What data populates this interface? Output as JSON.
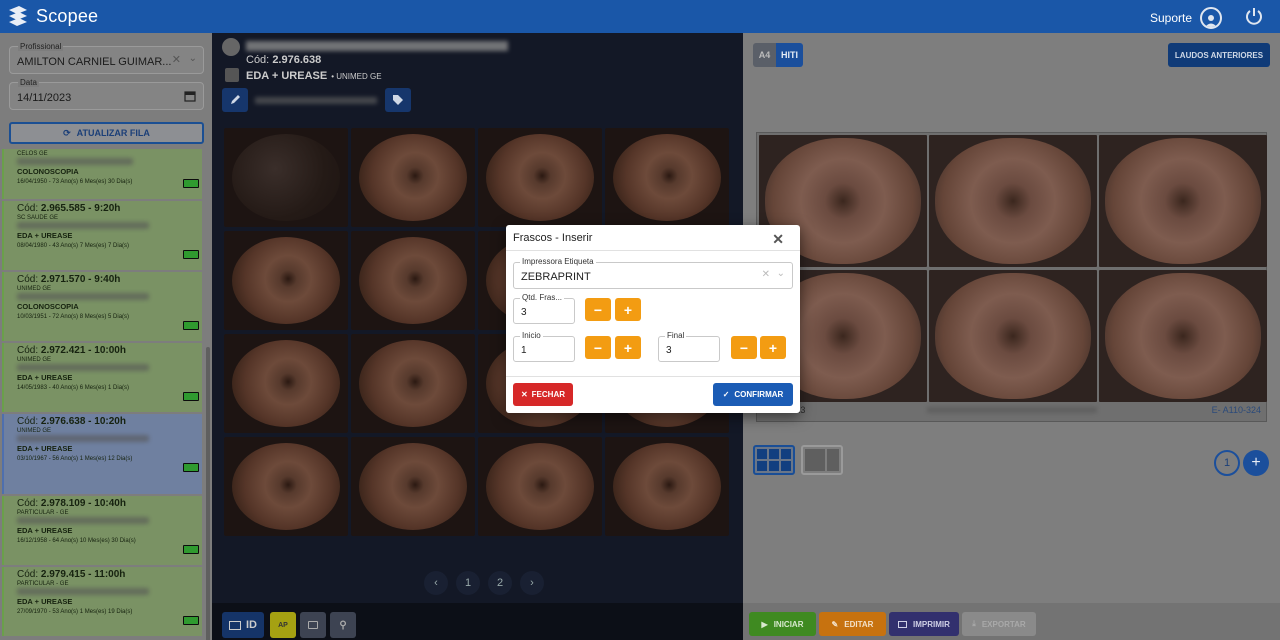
{
  "app": {
    "name": "Scopee",
    "support_label": "Suporte"
  },
  "filters": {
    "profissional_label": "Profissional",
    "profissional_value": "AMILTON CARNIEL GUIMAR...",
    "data_label": "Data",
    "data_value": "14/11/2023",
    "refresh_label": "ATUALIZAR FILA"
  },
  "queue": [
    {
      "cod_prefix": "",
      "cod": "",
      "time": "",
      "insurer": "CELOS GE",
      "exam": "COLONOSCOPIA",
      "info": "16/04/1950 - 73 Ano(s) 6 Mes(es) 30 Dia(s)",
      "selected": false
    },
    {
      "cod_prefix": "Cód: ",
      "cod": "2.965.585 - 9:20h",
      "insurer": "SC SAUDE GE",
      "exam": "EDA + UREASE",
      "info": "08/04/1980 - 43 Ano(s) 7 Mes(es) 7 Dia(s)",
      "selected": false
    },
    {
      "cod_prefix": "Cód: ",
      "cod": "2.971.570 - 9:40h",
      "insurer": "UNIMED GE",
      "exam": "COLONOSCOPIA",
      "info": "10/03/1951 - 72 Ano(s) 8 Mes(es) 5 Dia(s)",
      "selected": false
    },
    {
      "cod_prefix": "Cód: ",
      "cod": "2.972.421 - 10:00h",
      "insurer": "UNIMED GE",
      "exam": "EDA + UREASE",
      "info": "14/05/1983 - 40 Ano(s) 6 Mes(es) 1 Dia(s)",
      "selected": false
    },
    {
      "cod_prefix": "Cód: ",
      "cod": "2.976.638 - 10:20h",
      "insurer": "UNIMED GE",
      "exam": "EDA + UREASE",
      "info": "03/10/1967 - 56 Ano(s) 1 Mes(es) 12 Dia(s)",
      "selected": true
    },
    {
      "cod_prefix": "Cód: ",
      "cod": "2.978.109 - 10:40h",
      "insurer": "PARTICULAR - GE",
      "exam": "EDA + UREASE",
      "info": "16/12/1958 - 64 Ano(s) 10 Mes(es) 30 Dia(s)",
      "selected": false
    },
    {
      "cod_prefix": "Cód: ",
      "cod": "2.979.415 - 11:00h",
      "insurer": "PARTICULAR - GE",
      "exam": "EDA + UREASE",
      "info": "27/09/1970 - 53 Ano(s) 1 Mes(es) 19 Dia(s)",
      "selected": false
    }
  ],
  "patient": {
    "cod_label": "Cód:",
    "cod": "2.976.638",
    "exam": "EDA + UREASE",
    "insurer": "• UNIMED GE"
  },
  "pagination": {
    "pages": [
      "1",
      "2"
    ],
    "prev": "‹",
    "next": "›"
  },
  "center_toolbar": {
    "id_label": "ID",
    "ap_label": "AP"
  },
  "right": {
    "toggle": [
      "A4",
      "HITI"
    ],
    "laudos_label": "LAUDOS ANTERIORES",
    "footer_date": "14/11/2023",
    "footer_equip": "E- A110-324",
    "count": "1",
    "add_label": "+"
  },
  "actions": {
    "iniciar": "INICIAR",
    "editar": "EDITAR",
    "imprimir": "IMPRIMIR",
    "exportar": "EXPORTAR"
  },
  "modal": {
    "title": "Frascos - Inserir",
    "impressora_label": "Impressora Etiqueta",
    "impressora_value": "ZEBRAPRINT",
    "qtd_label": "Qtd. Fras...",
    "qtd_value": "3",
    "inicio_label": "Inicio",
    "inicio_value": "1",
    "final_label": "Final",
    "final_value": "3",
    "minus": "−",
    "plus": "+",
    "fechar": "FECHAR",
    "confirmar": "CONFIRMAR"
  },
  "colors": {
    "brand": "#1a57a8",
    "danger": "#d62828",
    "warning": "#f39c12",
    "success": "#2f9a2f"
  }
}
